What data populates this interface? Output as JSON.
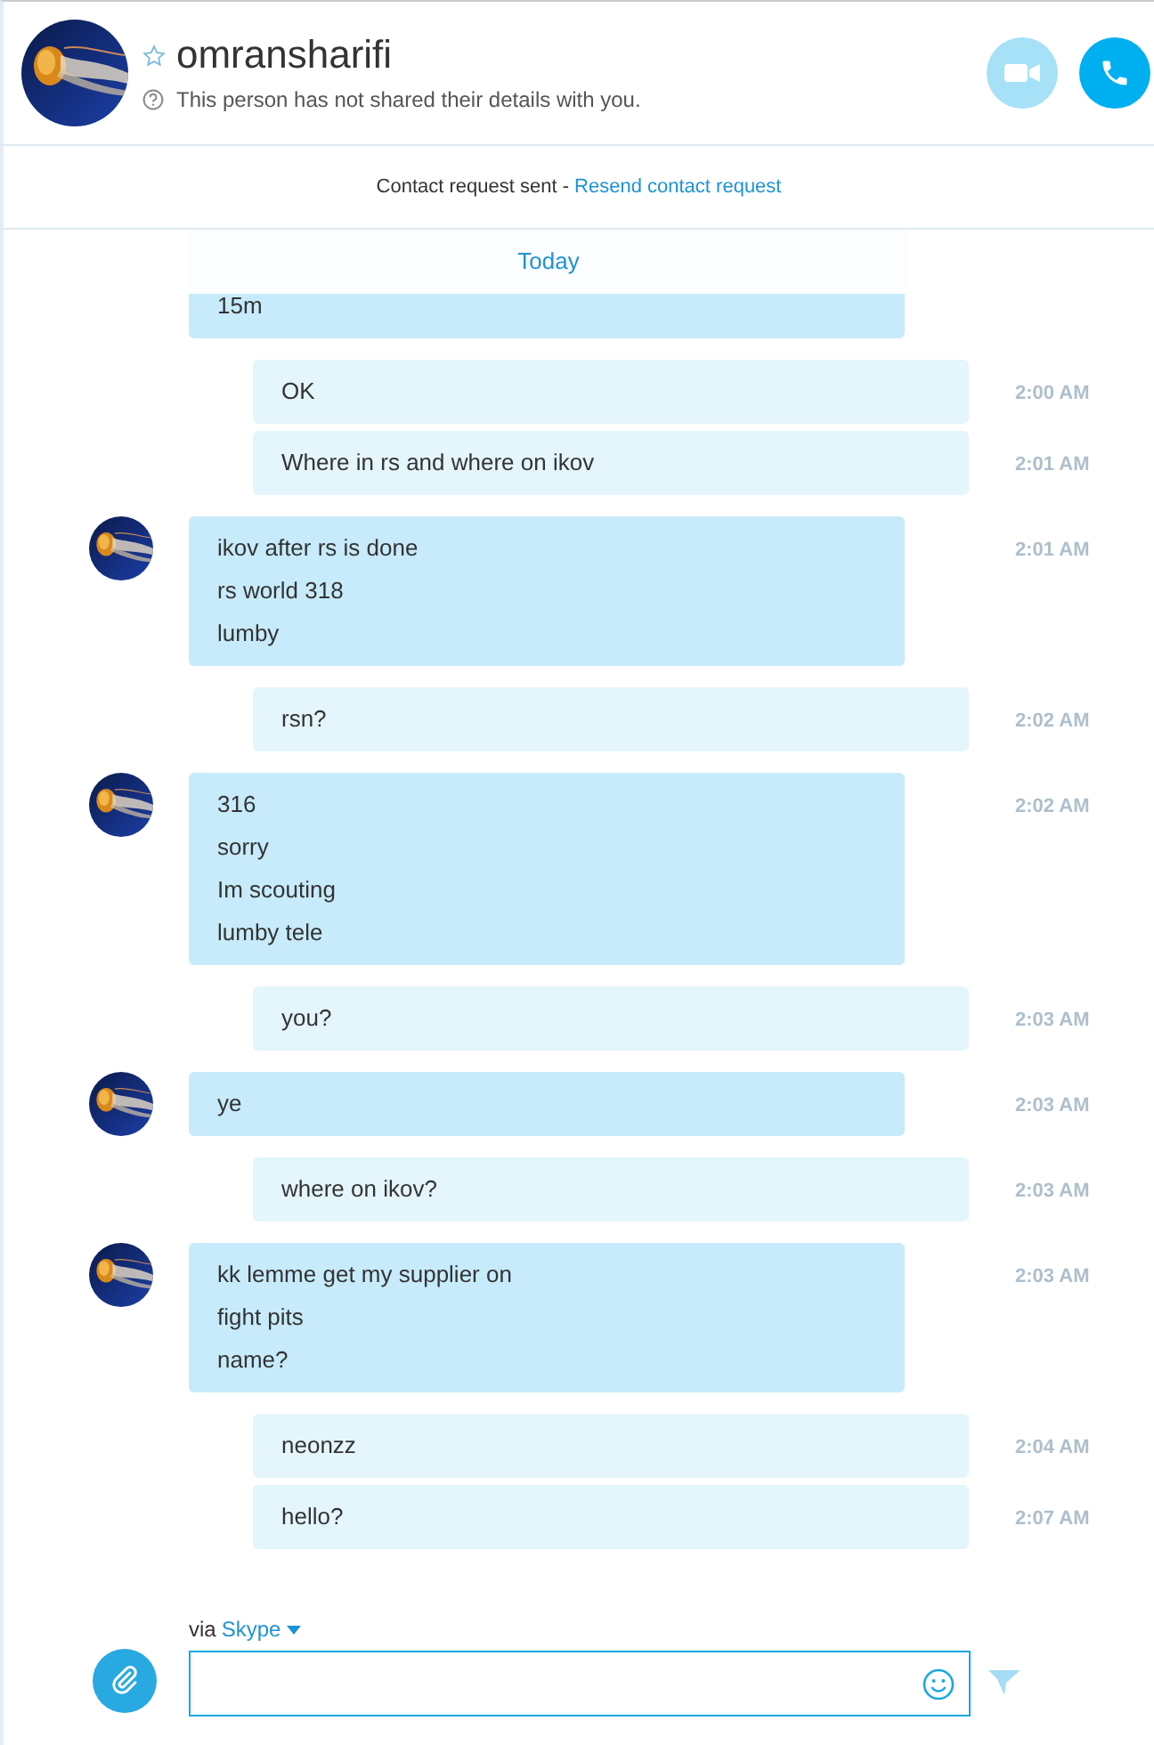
{
  "contact": {
    "name": "omransharifi",
    "favorite": false,
    "status_text": "This person has not shared their details with you."
  },
  "contact_request": {
    "text": "Contact request sent - ",
    "link": "Resend contact request"
  },
  "date_divider": "Today",
  "messages": [
    {
      "kind": "incoming",
      "lines": [
        "15m"
      ]
    },
    {
      "kind": "outgoing",
      "lines": [
        "OK"
      ],
      "time": "2:00 AM"
    },
    {
      "kind": "outgoing",
      "lines": [
        "Where in rs and where on ikov"
      ],
      "time": "2:01 AM"
    },
    {
      "kind": "incoming",
      "lines": [
        "ikov after rs is done",
        "rs world 318",
        "lumby"
      ],
      "time": "2:01 AM"
    },
    {
      "kind": "outgoing",
      "lines": [
        "rsn?"
      ],
      "time": "2:02 AM"
    },
    {
      "kind": "incoming",
      "lines": [
        "316",
        "sorry",
        "Im scouting",
        "lumby tele"
      ],
      "time": "2:02 AM"
    },
    {
      "kind": "outgoing",
      "lines": [
        "you?"
      ],
      "time": "2:03 AM"
    },
    {
      "kind": "incoming",
      "lines": [
        "ye"
      ],
      "time": "2:03 AM"
    },
    {
      "kind": "outgoing",
      "lines": [
        "where on ikov?"
      ],
      "time": "2:03 AM"
    },
    {
      "kind": "incoming",
      "lines": [
        "kk lemme get my supplier on",
        "fight pits",
        "name?"
      ],
      "time": "2:03 AM"
    },
    {
      "kind": "outgoing",
      "lines": [
        "neonzz"
      ],
      "time": "2:04 AM"
    },
    {
      "kind": "outgoing",
      "lines": [
        "hello?"
      ],
      "time": "2:07 AM"
    }
  ],
  "composer": {
    "via": "via",
    "service": "Skype"
  }
}
